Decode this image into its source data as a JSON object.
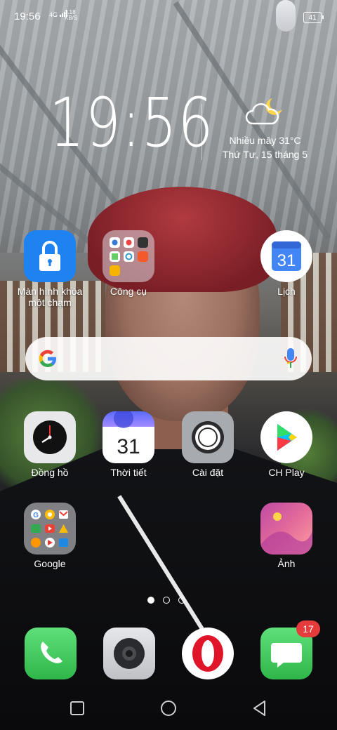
{
  "status_bar": {
    "time": "19:56",
    "network": "4G",
    "net_speed": "0.18\nKB/S",
    "battery": "41"
  },
  "clock_widget": {
    "time": "19:56",
    "weather": "Nhiều mây 31°C",
    "date": "Thứ Tư, 15 tháng 5",
    "weather_icon": "cloud-moon-icon"
  },
  "apps": [
    {
      "label": "Màn hình khóa một chạm",
      "icon": "lock-icon"
    },
    {
      "label": "Công cụ",
      "icon": "folder-tools-icon"
    },
    {
      "label": "Lịch",
      "icon": "calendar-icon",
      "day": "31"
    },
    {
      "label": "Đồng hồ",
      "icon": "clock-icon"
    },
    {
      "label": "Thời tiết",
      "icon": "weather-icon",
      "day": "31"
    },
    {
      "label": "Cài đặt",
      "icon": "gear-icon"
    },
    {
      "label": "CH Play",
      "icon": "play-store-icon"
    },
    {
      "label": "Google",
      "icon": "folder-google-icon"
    },
    {
      "label": "Ảnh",
      "icon": "photos-icon"
    }
  ],
  "search": {
    "logo": "G",
    "icon": "mic-icon"
  },
  "page_dots": {
    "count": 3,
    "active": 0
  },
  "dock": {
    "apps": [
      "phone-icon",
      "camera-icon",
      "opera-icon",
      "messages-icon"
    ],
    "messages_badge": "17"
  },
  "nav": [
    "recent-apps-icon",
    "home-icon",
    "back-icon"
  ],
  "colors": {
    "lock": "#1e82f0",
    "badge": "#e63b3b",
    "google_blue": "#4285f4"
  }
}
